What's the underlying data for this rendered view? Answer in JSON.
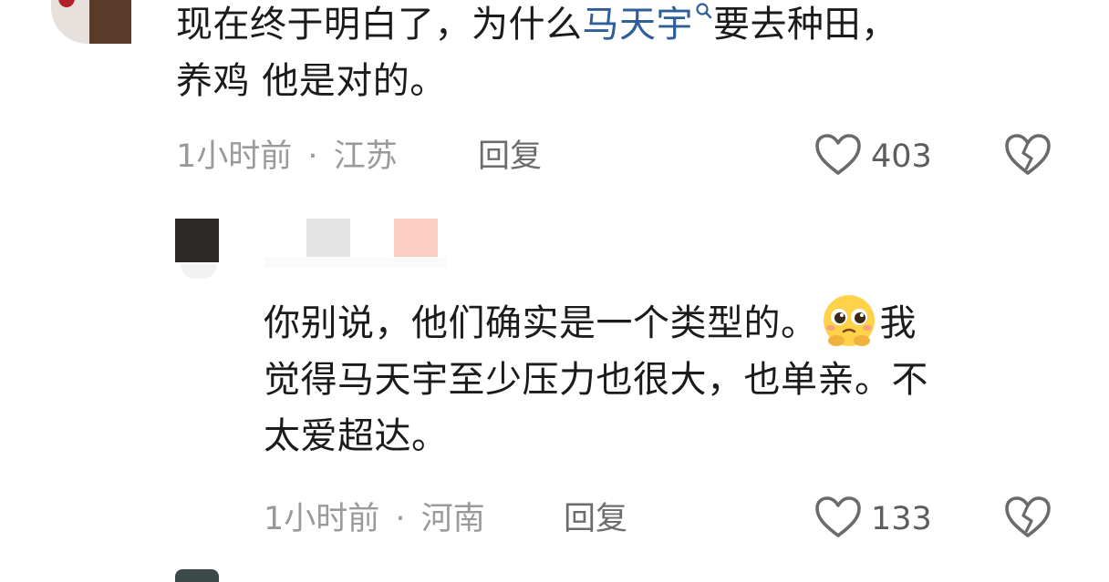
{
  "comments": [
    {
      "text_before_link": "现在终于明白了，为什么",
      "link_text": "马天宇",
      "text_after_link": "要去种田，",
      "line2": "养鸡 他是对的。",
      "time": "1小时前",
      "separator": "·",
      "location": "江苏",
      "reply_label": "回复",
      "like_count": "403"
    },
    {
      "line1_before_emoji": "你别说，他们确实是一个类型的。",
      "emoji": "pleading-face",
      "line1_after_emoji": "我",
      "line2": "觉得马天宇至少压力也很大，也单亲。不",
      "line3": "太爱超达。",
      "time": "1小时前",
      "separator": "·",
      "location": "河南",
      "reply_label": "回复",
      "like_count": "133"
    }
  ],
  "colors": {
    "text": "#1b1b1b",
    "link": "#2f5f98",
    "meta": "#9a9a9a",
    "icon": "#6a6a6a"
  }
}
